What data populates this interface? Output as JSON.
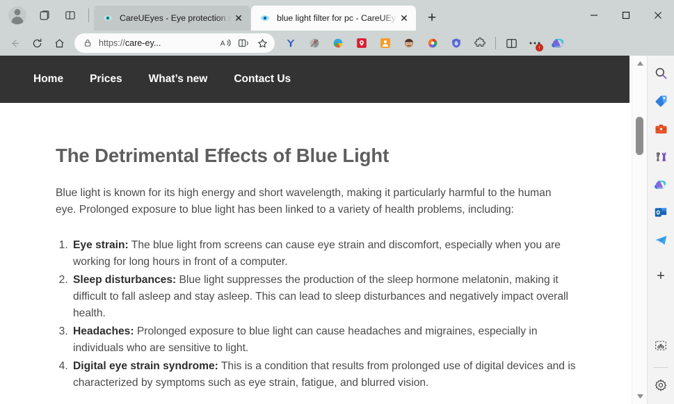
{
  "window": {
    "controls": {
      "minimize": "—",
      "maximize": "□",
      "close": "✕"
    }
  },
  "tabstrip": {
    "profile_label": "Profile",
    "tabs": [
      {
        "title": "CareUEyes - Eye protection softw",
        "favicon": "eye-icon",
        "active": false,
        "close_label": "✕"
      },
      {
        "title": "blue light filter for pc - CareUEye",
        "favicon": "eye-icon",
        "active": true,
        "close_label": "✕"
      }
    ],
    "new_tab_label": "+"
  },
  "toolbar": {
    "back_label": "←",
    "refresh_label": "↻",
    "home_label": "Home",
    "url_prefix": "https://",
    "url_text": "care-ey...",
    "read_aloud_label": "A",
    "immersive_reader_label": "Immersive Reader",
    "favorite_label": "☆",
    "extensions": [
      {
        "name": "yandex-extension-icon",
        "color": "#2b5fd9"
      },
      {
        "name": "grayscale-extension-icon",
        "color": "#9d9d9d"
      },
      {
        "name": "colorful-extension-icon",
        "color": "#3aa0d8"
      },
      {
        "name": "ghostery-extension-icon",
        "color": "#d81a33"
      },
      {
        "name": "lastpass-extension-icon",
        "color": "#f5a623"
      },
      {
        "name": "avatar-extension-icon",
        "color": "#8a6c52"
      },
      {
        "name": "colorzilla-extension-icon",
        "color": "#ef7e1a"
      },
      {
        "name": "shield-extension-icon",
        "color": "#5a5fd4"
      },
      {
        "name": "puzzle-extensions-icon",
        "color": "#3b3b3b"
      }
    ],
    "split_screen_label": "Split screen",
    "more_label": "…",
    "more_badge": "↑",
    "copilot_label": "Copilot"
  },
  "page": {
    "site_nav": [
      {
        "label": "Home"
      },
      {
        "label": "Prices"
      },
      {
        "label": "What’s new"
      },
      {
        "label": "Contact Us"
      }
    ],
    "heading": "The Detrimental Effects of Blue Light",
    "intro": "Blue light is known for its high energy and short wavelength, making it particularly harmful to the human eye. Prolonged exposure to blue light has been linked to a variety of health problems, including:",
    "effects": [
      {
        "term": "Eye strain:",
        "text": " The blue light from screens can cause eye strain and discomfort, especially when you are working for long hours in front of a computer."
      },
      {
        "term": "Sleep disturbances:",
        "text": " Blue light suppresses the production of the sleep hormone melatonin, making it difficult to fall asleep and stay asleep. This can lead to sleep disturbances and negatively impact overall health."
      },
      {
        "term": "Headaches:",
        "text": " Prolonged exposure to blue light can cause headaches and migraines, especially in individuals who are sensitive to light."
      },
      {
        "term": "Digital eye strain syndrome:",
        "text": " This is a condition that results from prolonged use of digital devices and is characterized by symptoms such as eye strain, fatigue, and blurred vision."
      }
    ]
  },
  "sidebar": {
    "items": [
      {
        "name": "search-icon",
        "label": "Search"
      },
      {
        "name": "shopping-tag-icon",
        "label": "Shopping"
      },
      {
        "name": "tools-briefcase-icon",
        "label": "Tools"
      },
      {
        "name": "games-chess-icon",
        "label": "Games"
      },
      {
        "name": "copilot-icon",
        "label": "Copilot"
      },
      {
        "name": "outlook-icon",
        "label": "Outlook"
      },
      {
        "name": "telegram-icon",
        "label": "Telegram"
      }
    ],
    "add_label": "+",
    "customize_label": "Customize",
    "settings_label": "Settings"
  },
  "colors": {
    "chrome_bg": "#cfd4d4",
    "active_tab": "#fbfbfb",
    "site_nav_bg": "#333333",
    "heading": "#5e5e5e",
    "body_text": "#4a4a4a"
  }
}
